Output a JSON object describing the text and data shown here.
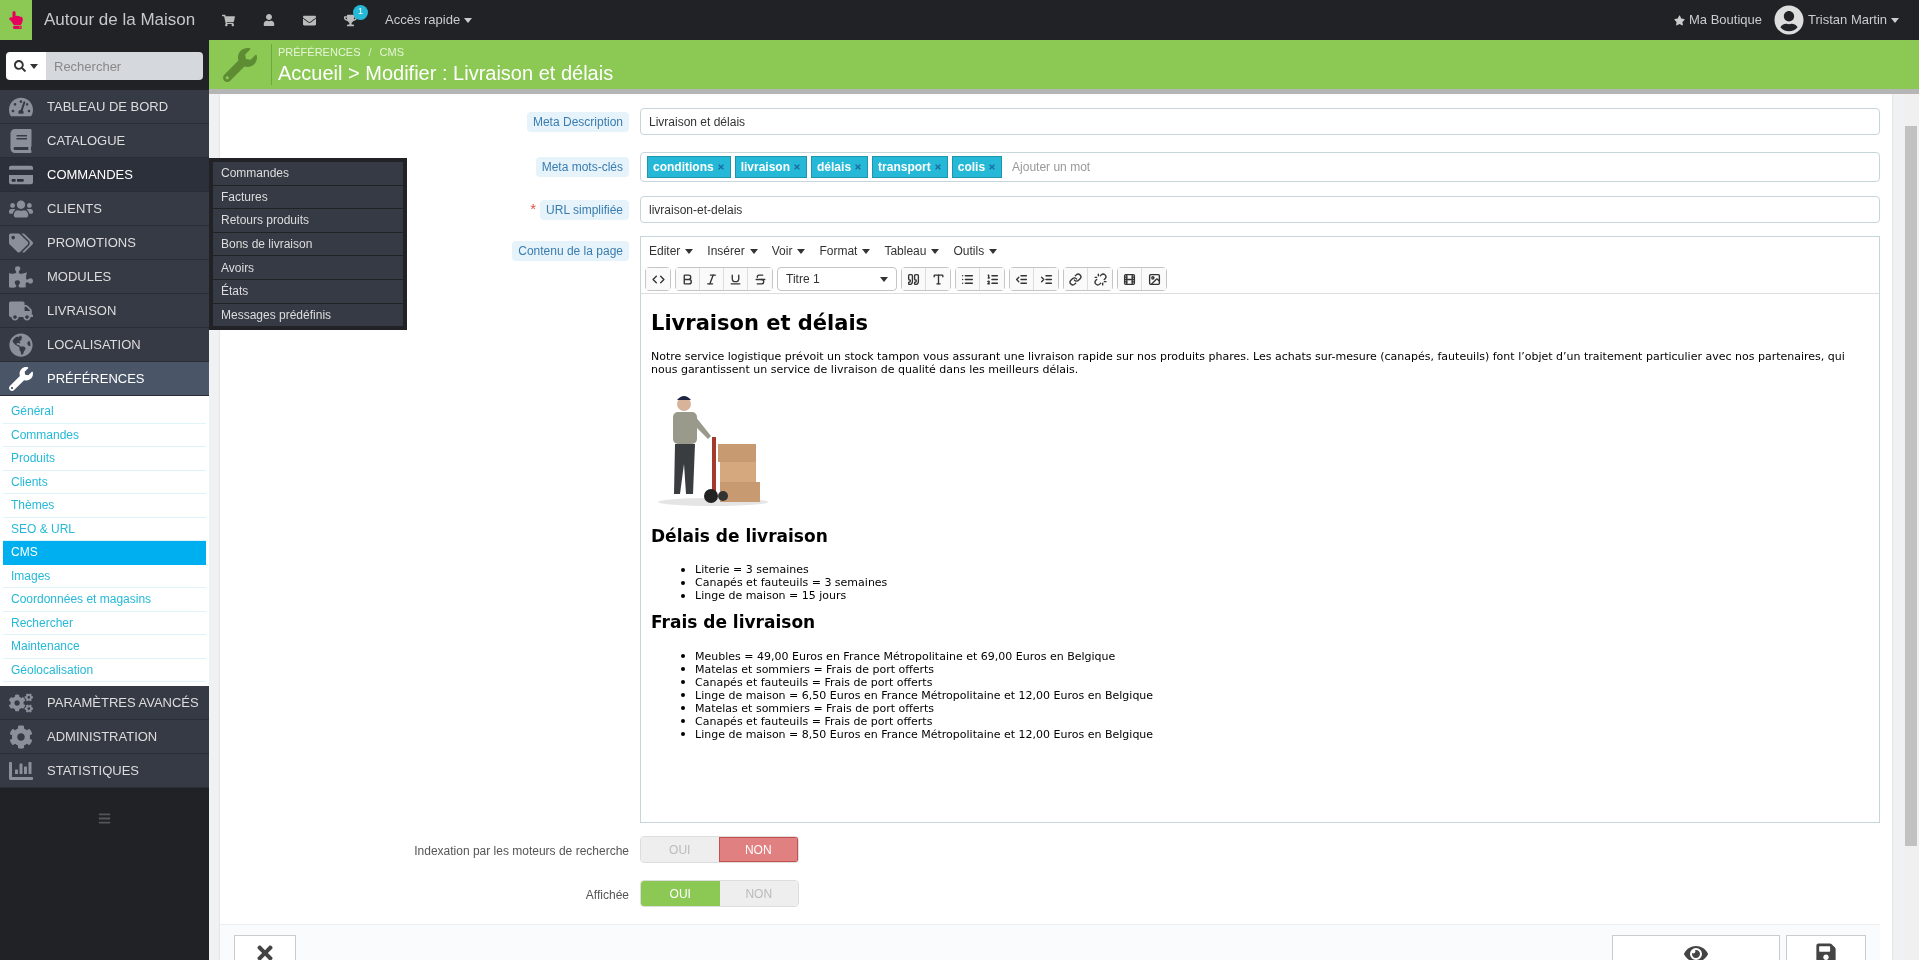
{
  "topbar": {
    "brand": "Autour de la Maison",
    "notification_count": "1",
    "quick_access": "Accès rapide",
    "shop_link": "Ma Boutique",
    "user_name": "Tristan Martin"
  },
  "sidebar": {
    "search": {
      "placeholder": "Rechercher"
    },
    "items": [
      {
        "label": "TABLEAU DE BORD",
        "selected": false,
        "hovered": false
      },
      {
        "label": "CATALOGUE",
        "selected": false,
        "hovered": false
      },
      {
        "label": "COMMANDES",
        "selected": false,
        "hovered": true,
        "flyout": [
          "Commandes",
          "Factures",
          "Retours produits",
          "Bons de livraison",
          "Avoirs",
          "États",
          "Messages prédéfinis"
        ]
      },
      {
        "label": "CLIENTS",
        "selected": false,
        "hovered": false
      },
      {
        "label": "PROMOTIONS",
        "selected": false,
        "hovered": false
      },
      {
        "label": "MODULES",
        "selected": false,
        "hovered": false
      },
      {
        "label": "LIVRAISON",
        "selected": false,
        "hovered": false
      },
      {
        "label": "LOCALISATION",
        "selected": false,
        "hovered": false
      },
      {
        "label": "PRÉFÉRENCES",
        "selected": true,
        "hovered": false,
        "children": [
          {
            "label": "Général",
            "selected": false
          },
          {
            "label": "Commandes",
            "selected": false
          },
          {
            "label": "Produits",
            "selected": false
          },
          {
            "label": "Clients",
            "selected": false
          },
          {
            "label": "Thèmes",
            "selected": false
          },
          {
            "label": "SEO & URL",
            "selected": false
          },
          {
            "label": "CMS",
            "selected": true
          },
          {
            "label": "Images",
            "selected": false
          },
          {
            "label": "Coordonnées et magasins",
            "selected": false
          },
          {
            "label": "Rechercher",
            "selected": false
          },
          {
            "label": "Maintenance",
            "selected": false
          },
          {
            "label": "Géolocalisation",
            "selected": false
          }
        ]
      },
      {
        "label": "PARAMÈTRES AVANCÉS",
        "selected": false,
        "hovered": false
      },
      {
        "label": "ADMINISTRATION",
        "selected": false,
        "hovered": false
      },
      {
        "label": "STATISTIQUES",
        "selected": false,
        "hovered": false
      }
    ]
  },
  "header": {
    "breadcrumb": [
      "PRÉFÉRENCES",
      "CMS"
    ],
    "breadcrumb_separator": "/",
    "title": "Accueil > Modifier : Livraison et délais"
  },
  "form": {
    "meta_description": {
      "label": "Meta Description",
      "value": "Livraison et délais"
    },
    "meta_keywords": {
      "label": "Meta mots-clés",
      "tags": [
        "conditions",
        "livraison",
        "délais",
        "transport",
        "colis"
      ],
      "placeholder": "Ajouter un mot"
    },
    "friendly_url": {
      "label": "URL simplifiée",
      "required": true,
      "required_mark": "*",
      "value": "livraison-et-delais"
    },
    "content": {
      "label": "Contenu de la page",
      "menus": [
        "Editer",
        "Insérer",
        "Voir",
        "Format",
        "Tableau",
        "Outils"
      ],
      "block_format": "Titre 1",
      "document": {
        "title": "Livraison et délais",
        "intro": "Notre service logistique prévoit un stock tampon vous assurant une livraison rapide sur nos produits phares. Les achats sur-mesure (canapés, fauteuils) font l’objet d’un traitement particulier avec nos partenaires, qui nous garantissent un service de livraison de qualité dans les meilleurs délais.",
        "sections": [
          {
            "heading": "Délais de livraison",
            "items": [
              "Literie = 3 semaines",
              "Canapés et fauteuils = 3 semaines",
              "Linge de maison = 15 jours"
            ]
          },
          {
            "heading": "Frais de livraison",
            "items": [
              "Meubles = 49,00 Euros en France Métropolitaine et 69,00 Euros en Belgique",
              "Matelas et sommiers = Frais de port offerts",
              "Canapés et fauteuils = Frais de port offerts",
              "Linge de maison = 6,50 Euros en France Métropolitaine et 12,00 Euros en Belgique",
              "Matelas et sommiers = Frais de port offerts",
              "Canapés et fauteuils = Frais de port offerts",
              "Linge de maison = 8,50 Euros en France Métropolitaine et 12,00 Euros en Belgique"
            ]
          }
        ]
      }
    },
    "toggles": [
      {
        "label": "Indexation par les moteurs de recherche",
        "options": [
          {
            "label": "OUI",
            "kind": "positive",
            "selected": false
          },
          {
            "label": "NON",
            "kind": "negative",
            "selected": true
          }
        ]
      },
      {
        "label": "Affichée",
        "options": [
          {
            "label": "OUI",
            "kind": "positive",
            "selected": true
          },
          {
            "label": "NON",
            "kind": "negative",
            "selected": false
          }
        ]
      }
    ]
  }
}
